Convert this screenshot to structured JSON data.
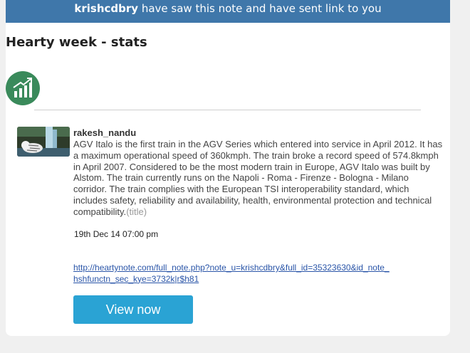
{
  "banner": {
    "username": "krishcdbry",
    "message": " have saw this note and have sent link to you"
  },
  "page": {
    "title": "Hearty week - stats"
  },
  "icons": {
    "stats": "stats-chart-icon",
    "avatar": "tiger-waterfall-avatar"
  },
  "note": {
    "author": "rakesh_nandu",
    "body": "AGV Italo is the first train in the AGV Series which entered into service in April 2012. It has a maximum operational speed of 360kmph. The train broke a record speed of 574.8kmph in April 2007. Considered to be the most modern train in Europe, AGV Italo was built by Alstom. The train currently runs on the Napoli - Roma - Firenze - Bologna - Milano corridor. The train complies with the European TSI interoperability standard, which includes safety, reliability and availability, health, environmental protection and technical compatibility.",
    "tag": "(title)",
    "date": "19th Dec 14 07:00 pm",
    "link_line1": "http://heartynote.com/full_note.php?note_u=krishcdbry&full_id=35323630&id_note_",
    "link_line2": "hshfunctn_sec_kye=3732k|r$h81"
  },
  "actions": {
    "view_label": "View now"
  },
  "colors": {
    "banner": "#3f77aa",
    "icon_bg": "#3a8a5b",
    "button": "#2aa3d4",
    "link": "#2a55a8"
  }
}
